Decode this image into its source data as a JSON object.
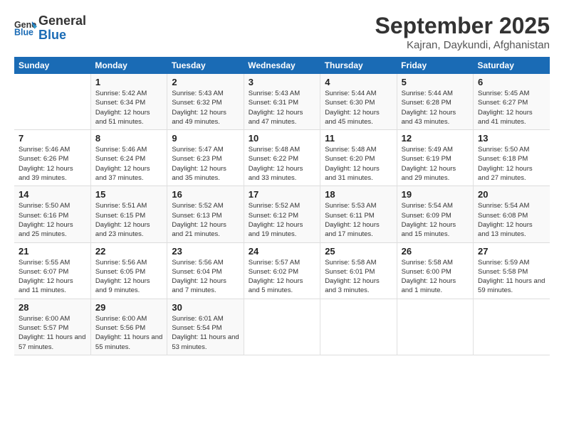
{
  "header": {
    "logo_line1": "General",
    "logo_line2": "Blue",
    "title": "September 2025",
    "subtitle": "Kajran, Daykundi, Afghanistan"
  },
  "columns": [
    "Sunday",
    "Monday",
    "Tuesday",
    "Wednesday",
    "Thursday",
    "Friday",
    "Saturday"
  ],
  "weeks": [
    {
      "days": [
        {
          "num": "",
          "sunrise": "",
          "sunset": "",
          "daylight": ""
        },
        {
          "num": "1",
          "sunrise": "Sunrise: 5:42 AM",
          "sunset": "Sunset: 6:34 PM",
          "daylight": "Daylight: 12 hours and 51 minutes."
        },
        {
          "num": "2",
          "sunrise": "Sunrise: 5:43 AM",
          "sunset": "Sunset: 6:32 PM",
          "daylight": "Daylight: 12 hours and 49 minutes."
        },
        {
          "num": "3",
          "sunrise": "Sunrise: 5:43 AM",
          "sunset": "Sunset: 6:31 PM",
          "daylight": "Daylight: 12 hours and 47 minutes."
        },
        {
          "num": "4",
          "sunrise": "Sunrise: 5:44 AM",
          "sunset": "Sunset: 6:30 PM",
          "daylight": "Daylight: 12 hours and 45 minutes."
        },
        {
          "num": "5",
          "sunrise": "Sunrise: 5:44 AM",
          "sunset": "Sunset: 6:28 PM",
          "daylight": "Daylight: 12 hours and 43 minutes."
        },
        {
          "num": "6",
          "sunrise": "Sunrise: 5:45 AM",
          "sunset": "Sunset: 6:27 PM",
          "daylight": "Daylight: 12 hours and 41 minutes."
        }
      ]
    },
    {
      "days": [
        {
          "num": "7",
          "sunrise": "Sunrise: 5:46 AM",
          "sunset": "Sunset: 6:26 PM",
          "daylight": "Daylight: 12 hours and 39 minutes."
        },
        {
          "num": "8",
          "sunrise": "Sunrise: 5:46 AM",
          "sunset": "Sunset: 6:24 PM",
          "daylight": "Daylight: 12 hours and 37 minutes."
        },
        {
          "num": "9",
          "sunrise": "Sunrise: 5:47 AM",
          "sunset": "Sunset: 6:23 PM",
          "daylight": "Daylight: 12 hours and 35 minutes."
        },
        {
          "num": "10",
          "sunrise": "Sunrise: 5:48 AM",
          "sunset": "Sunset: 6:22 PM",
          "daylight": "Daylight: 12 hours and 33 minutes."
        },
        {
          "num": "11",
          "sunrise": "Sunrise: 5:48 AM",
          "sunset": "Sunset: 6:20 PM",
          "daylight": "Daylight: 12 hours and 31 minutes."
        },
        {
          "num": "12",
          "sunrise": "Sunrise: 5:49 AM",
          "sunset": "Sunset: 6:19 PM",
          "daylight": "Daylight: 12 hours and 29 minutes."
        },
        {
          "num": "13",
          "sunrise": "Sunrise: 5:50 AM",
          "sunset": "Sunset: 6:18 PM",
          "daylight": "Daylight: 12 hours and 27 minutes."
        }
      ]
    },
    {
      "days": [
        {
          "num": "14",
          "sunrise": "Sunrise: 5:50 AM",
          "sunset": "Sunset: 6:16 PM",
          "daylight": "Daylight: 12 hours and 25 minutes."
        },
        {
          "num": "15",
          "sunrise": "Sunrise: 5:51 AM",
          "sunset": "Sunset: 6:15 PM",
          "daylight": "Daylight: 12 hours and 23 minutes."
        },
        {
          "num": "16",
          "sunrise": "Sunrise: 5:52 AM",
          "sunset": "Sunset: 6:13 PM",
          "daylight": "Daylight: 12 hours and 21 minutes."
        },
        {
          "num": "17",
          "sunrise": "Sunrise: 5:52 AM",
          "sunset": "Sunset: 6:12 PM",
          "daylight": "Daylight: 12 hours and 19 minutes."
        },
        {
          "num": "18",
          "sunrise": "Sunrise: 5:53 AM",
          "sunset": "Sunset: 6:11 PM",
          "daylight": "Daylight: 12 hours and 17 minutes."
        },
        {
          "num": "19",
          "sunrise": "Sunrise: 5:54 AM",
          "sunset": "Sunset: 6:09 PM",
          "daylight": "Daylight: 12 hours and 15 minutes."
        },
        {
          "num": "20",
          "sunrise": "Sunrise: 5:54 AM",
          "sunset": "Sunset: 6:08 PM",
          "daylight": "Daylight: 12 hours and 13 minutes."
        }
      ]
    },
    {
      "days": [
        {
          "num": "21",
          "sunrise": "Sunrise: 5:55 AM",
          "sunset": "Sunset: 6:07 PM",
          "daylight": "Daylight: 12 hours and 11 minutes."
        },
        {
          "num": "22",
          "sunrise": "Sunrise: 5:56 AM",
          "sunset": "Sunset: 6:05 PM",
          "daylight": "Daylight: 12 hours and 9 minutes."
        },
        {
          "num": "23",
          "sunrise": "Sunrise: 5:56 AM",
          "sunset": "Sunset: 6:04 PM",
          "daylight": "Daylight: 12 hours and 7 minutes."
        },
        {
          "num": "24",
          "sunrise": "Sunrise: 5:57 AM",
          "sunset": "Sunset: 6:02 PM",
          "daylight": "Daylight: 12 hours and 5 minutes."
        },
        {
          "num": "25",
          "sunrise": "Sunrise: 5:58 AM",
          "sunset": "Sunset: 6:01 PM",
          "daylight": "Daylight: 12 hours and 3 minutes."
        },
        {
          "num": "26",
          "sunrise": "Sunrise: 5:58 AM",
          "sunset": "Sunset: 6:00 PM",
          "daylight": "Daylight: 12 hours and 1 minute."
        },
        {
          "num": "27",
          "sunrise": "Sunrise: 5:59 AM",
          "sunset": "Sunset: 5:58 PM",
          "daylight": "Daylight: 11 hours and 59 minutes."
        }
      ]
    },
    {
      "days": [
        {
          "num": "28",
          "sunrise": "Sunrise: 6:00 AM",
          "sunset": "Sunset: 5:57 PM",
          "daylight": "Daylight: 11 hours and 57 minutes."
        },
        {
          "num": "29",
          "sunrise": "Sunrise: 6:00 AM",
          "sunset": "Sunset: 5:56 PM",
          "daylight": "Daylight: 11 hours and 55 minutes."
        },
        {
          "num": "30",
          "sunrise": "Sunrise: 6:01 AM",
          "sunset": "Sunset: 5:54 PM",
          "daylight": "Daylight: 11 hours and 53 minutes."
        },
        {
          "num": "",
          "sunrise": "",
          "sunset": "",
          "daylight": ""
        },
        {
          "num": "",
          "sunrise": "",
          "sunset": "",
          "daylight": ""
        },
        {
          "num": "",
          "sunrise": "",
          "sunset": "",
          "daylight": ""
        },
        {
          "num": "",
          "sunrise": "",
          "sunset": "",
          "daylight": ""
        }
      ]
    }
  ]
}
